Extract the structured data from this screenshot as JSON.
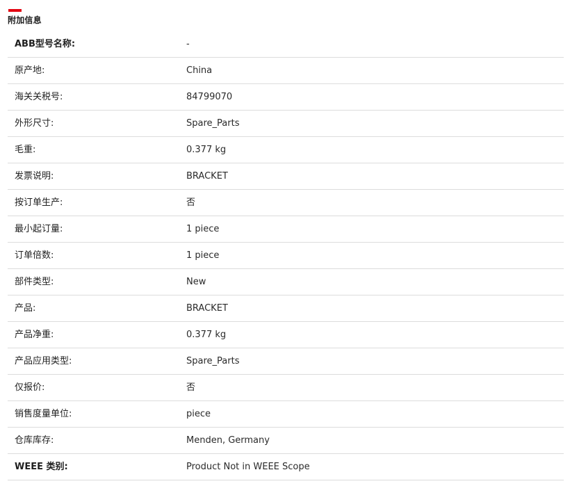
{
  "section": {
    "title": "附加信息",
    "accent_color": "#e30613"
  },
  "rows": [
    {
      "label": "ABB型号名称:",
      "value": "-"
    },
    {
      "label": "原产地:",
      "value": "China"
    },
    {
      "label": "海关关税号:",
      "value": "84799070"
    },
    {
      "label": "外形尺寸:",
      "value": "Spare_Parts"
    },
    {
      "label": "毛重:",
      "value": "0.377 kg"
    },
    {
      "label": "发票说明:",
      "value": "BRACKET"
    },
    {
      "label": "按订单生产:",
      "value": "否"
    },
    {
      "label": "最小起订量:",
      "value": "1 piece"
    },
    {
      "label": "订单倍数:",
      "value": "1 piece"
    },
    {
      "label": "部件类型:",
      "value": "New"
    },
    {
      "label": "产品:",
      "value": "BRACKET"
    },
    {
      "label": "产品净重:",
      "value": "0.377 kg"
    },
    {
      "label": "产品应用类型:",
      "value": "Spare_Parts"
    },
    {
      "label": "仅报价:",
      "value": "否"
    },
    {
      "label": "销售度量单位:",
      "value": "piece"
    },
    {
      "label": "仓库库存:",
      "value": "Menden, Germany"
    },
    {
      "label": "WEEE 类别:",
      "value": "Product Not in WEEE Scope"
    }
  ]
}
